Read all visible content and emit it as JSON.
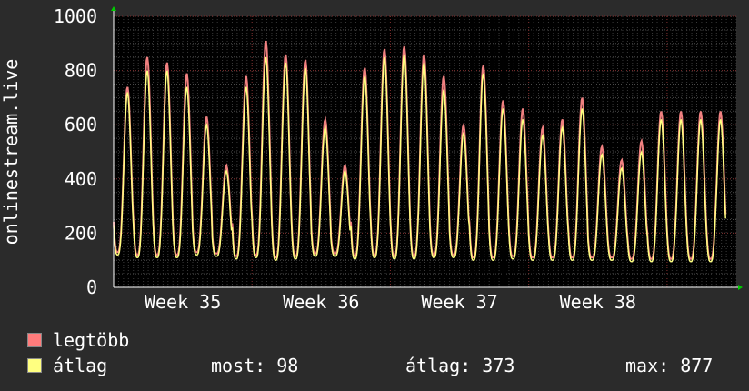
{
  "chart_data": {
    "type": "line",
    "ylabel": "onlinestream.live",
    "ylim": [
      0,
      1000
    ],
    "yticks": [
      0,
      200,
      400,
      600,
      800,
      1000
    ],
    "xlabels": [
      "Week 35",
      "Week 36",
      "Week 37",
      "Week 38"
    ],
    "x_unit": "day",
    "xlim": [
      0,
      31.5
    ],
    "week_label_days": [
      3.5,
      10.5,
      17.5,
      24.5
    ],
    "daily_peak_max": [
      740,
      850,
      830,
      790,
      630,
      450,
      780,
      910,
      860,
      840,
      620,
      450,
      810,
      880,
      890,
      860,
      780,
      600,
      820,
      690,
      660,
      590,
      620,
      700,
      520,
      470,
      540,
      650,
      650,
      650,
      650
    ],
    "daily_peak_avg": [
      720,
      800,
      800,
      740,
      600,
      430,
      740,
      850,
      830,
      810,
      590,
      430,
      780,
      850,
      860,
      830,
      730,
      570,
      790,
      660,
      620,
      560,
      590,
      660,
      490,
      440,
      500,
      620,
      620,
      620,
      620
    ],
    "daily_low_avg": [
      120,
      110,
      110,
      110,
      120,
      115,
      105,
      110,
      100,
      105,
      115,
      115,
      105,
      110,
      105,
      105,
      110,
      110,
      100,
      100,
      105,
      100,
      100,
      100,
      100,
      100,
      95,
      95,
      95,
      95,
      95
    ],
    "series": [
      {
        "name": "legtöbb",
        "color": "#f08080"
      },
      {
        "name": "átlag",
        "color": "#ffff80"
      }
    ]
  },
  "legend": {
    "max_label": "legtöbb",
    "avg_label": "átlag",
    "max_color": "#ff7b7b",
    "avg_color": "#ffff80"
  },
  "stats": {
    "now": "most: 98",
    "avg": "átlag: 373",
    "max": "max: 877"
  }
}
